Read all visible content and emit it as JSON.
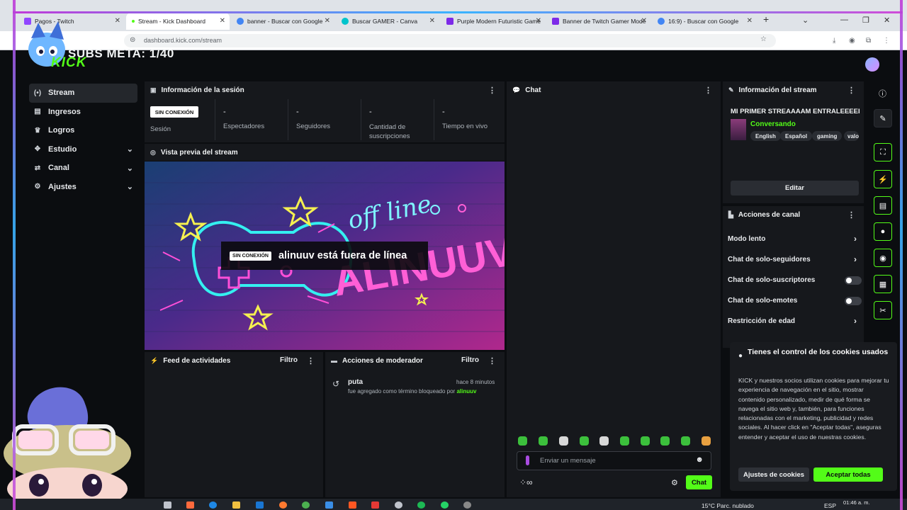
{
  "browser": {
    "tabs": [
      {
        "label": "Pagos - Twitch",
        "color": "#9146ff"
      },
      {
        "label": "Stream - Kick Dashboard",
        "color": "#53fc18",
        "active": true
      },
      {
        "label": "banner - Buscar con Google",
        "color": "#4285f4"
      },
      {
        "label": "Buscar GAMER - Canva",
        "color": "#00c4cc"
      },
      {
        "label": "Purple Modern Futuristic Game",
        "color": "#7d2ae8"
      },
      {
        "label": "Banner de Twitch Gamer Mode",
        "color": "#7d2ae8"
      },
      {
        "label": "16:9) - Buscar con Google",
        "color": "#4285f4"
      }
    ],
    "url": "dashboard.kick.com/stream"
  },
  "overlay": {
    "subs_meta": "SUBS META: 1/40",
    "logo_text": "KICK"
  },
  "sidebar": {
    "items": [
      {
        "label": "Stream",
        "icon": "broadcast-icon",
        "glyph": "(•)",
        "active": true
      },
      {
        "label": "Ingresos",
        "icon": "ledger-icon",
        "glyph": "▤"
      },
      {
        "label": "Logros",
        "icon": "trophy-icon",
        "glyph": "♛"
      },
      {
        "label": "Estudio",
        "icon": "studio-icon",
        "glyph": "✥",
        "expandable": true
      },
      {
        "label": "Canal",
        "icon": "channel-icon",
        "glyph": "⇄",
        "expandable": true
      },
      {
        "label": "Ajustes",
        "icon": "gear-icon",
        "glyph": "⚙",
        "expandable": true
      }
    ]
  },
  "session": {
    "title": "Información de la sesión",
    "badge": "SIN CONEXIÓN",
    "stats": [
      {
        "value": "",
        "label": "Sesión"
      },
      {
        "value": "-",
        "label": "Espectadores"
      },
      {
        "value": "-",
        "label": "Seguidores"
      },
      {
        "value": "-",
        "label": "Cantidad de suscripciones"
      },
      {
        "value": "-",
        "label": "Tiempo en vivo"
      }
    ]
  },
  "preview": {
    "title": "Vista previa del stream",
    "badge": "SIN CONEXIÓN",
    "message": "alinuuv está fuera de línea",
    "artwork": {
      "script": "off line",
      "name": "ALINUUV"
    }
  },
  "activity": {
    "title": "Feed de actividades",
    "filter": "Filtro"
  },
  "moderator": {
    "title": "Acciones de moderador",
    "filter": "Filtro",
    "entries": [
      {
        "term": "puta",
        "time": "hace 8 minutos",
        "description": "fue agregado como término bloqueado por",
        "user": "alinuuv"
      }
    ]
  },
  "chat": {
    "title": "Chat",
    "placeholder": "Enviar un mensaje",
    "send_label": "Chat"
  },
  "stream_info": {
    "title": "Información del stream",
    "stream_title": "MI PRIMER STREAAAAM ENTRALEEEEE",
    "category": "Conversando",
    "tags": [
      "English",
      "Español",
      "gaming",
      "valo"
    ],
    "edit_label": "Editar"
  },
  "channel_actions": {
    "title": "Acciones de canal",
    "items": [
      {
        "label": "Modo lento",
        "kind": "arrow"
      },
      {
        "label": "Chat de solo-seguidores",
        "kind": "arrow"
      },
      {
        "label": "Chat de solo-suscriptores",
        "kind": "toggle"
      },
      {
        "label": "Chat de solo-emotes",
        "kind": "toggle"
      },
      {
        "label": "Restricción de edad",
        "kind": "arrow"
      }
    ]
  },
  "cookies": {
    "title": "Tienes el control de los cookies usados",
    "body": "KICK y nuestros socios utilizan cookies para mejorar tu experiencia de navegación en el sitio, mostrar contenido personalizado, medir de qué forma se navega el sitio web y, también, para funciones relacionadas con el marketing, publicidad y redes sociales. Al hacer click en \"Aceptar todas\", aseguras entender y aceptar el uso de nuestras cookies.",
    "settings_label": "Ajustes de cookies",
    "accept_label": "Aceptar todas"
  },
  "taskbar": {
    "weather": "15°C  Parc. nublado",
    "lang": "ESP",
    "time": "01:46 a. m."
  },
  "colors": {
    "accent": "#53fc18",
    "panel": "#16181c",
    "background": "#0b0d10"
  }
}
